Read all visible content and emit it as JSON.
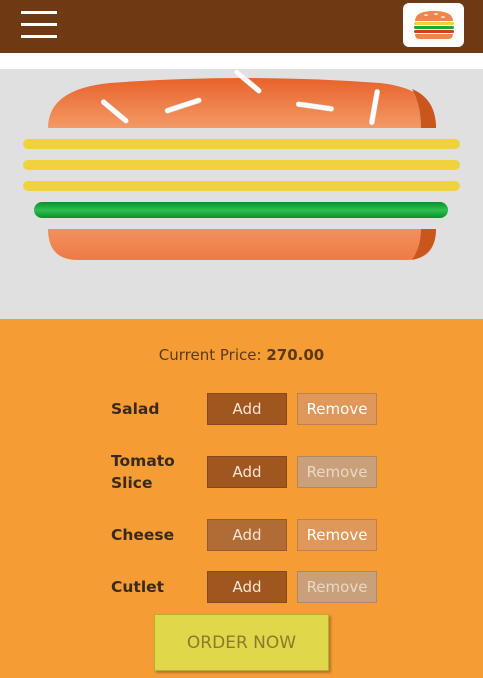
{
  "header": {
    "menu_icon": "hamburger-menu-icon",
    "logo_icon": "burger-logo-icon"
  },
  "burger": {
    "layers": [
      "top-bun",
      "cheese-slice",
      "cheese-slice",
      "cheese-slice",
      "salad-leaf",
      "bottom-bun"
    ],
    "colors": {
      "bun": "#f0844c",
      "bun_dark": "#c8561d",
      "cheese": "#efd23e",
      "salad": "#18a83a",
      "sesame": "#ffffff"
    }
  },
  "price": {
    "label": "Current Price:",
    "value": "270.00"
  },
  "ingredients": [
    {
      "name": "Salad",
      "add_label": "Add",
      "remove_label": "Remove"
    },
    {
      "name": "Tomato Slice",
      "add_label": "Add",
      "remove_label": "Remove"
    },
    {
      "name": "Cheese",
      "add_label": "Add",
      "remove_label": "Remove"
    },
    {
      "name": "Cutlet",
      "add_label": "Add",
      "remove_label": "Remove"
    }
  ],
  "order_button": "ORDER NOW",
  "colors": {
    "topbar": "#6f3a13",
    "controls_bg": "#f59c35",
    "preview_bg": "#e0e0e0",
    "order_bg": "#e0d74a"
  }
}
